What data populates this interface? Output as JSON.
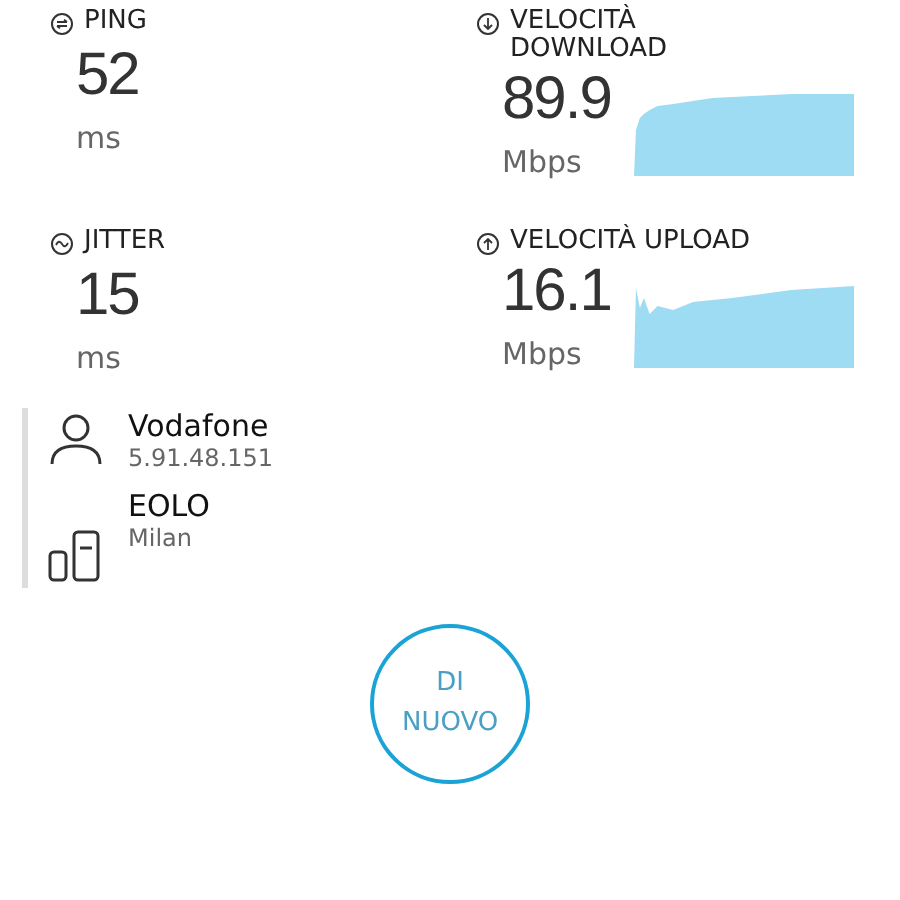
{
  "metrics": [
    {
      "kind": "ping",
      "label": "PING",
      "value": "52",
      "unit": "ms"
    },
    {
      "kind": "download",
      "label": "VELOCITÀ DOWNLOAD",
      "value": "89.9",
      "unit": "Mbps"
    },
    {
      "kind": "jitter",
      "label": "JITTER",
      "value": "15",
      "unit": "ms"
    },
    {
      "kind": "upload",
      "label": "VELOCITÀ UPLOAD",
      "value": "16.1",
      "unit": "Mbps"
    }
  ],
  "connection": [
    {
      "kind": "client",
      "name": "Vodafone",
      "detail": "5.91.48.151"
    },
    {
      "kind": "server",
      "name": "EOLO",
      "detail": "Milan"
    }
  ],
  "again_button": "DI NUOVO"
}
